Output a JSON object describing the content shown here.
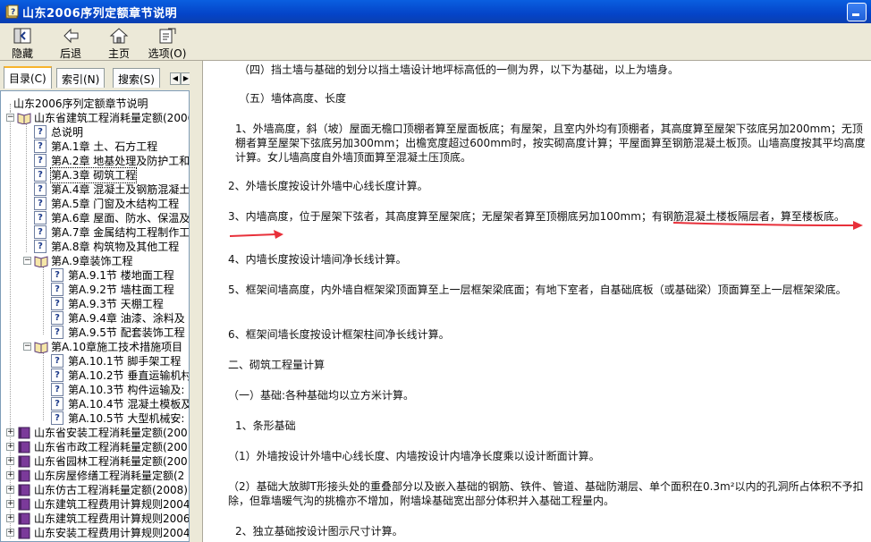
{
  "window": {
    "title": "山东2006序列定额章节说明"
  },
  "toolbar": {
    "buttons": [
      {
        "label": "隐藏",
        "icon": "hide-icon"
      },
      {
        "label": "后退",
        "icon": "back-arrow-icon"
      },
      {
        "label": "主页",
        "icon": "home-icon"
      },
      {
        "label": "选项(O)",
        "icon": "options-icon"
      }
    ]
  },
  "tabs": [
    {
      "label": "目录(C)",
      "active": true
    },
    {
      "label": "索引(N)",
      "active": false
    },
    {
      "label": "搜索(S)",
      "active": false
    }
  ],
  "tree": {
    "root": "山东2006序列定额章节说明",
    "items": [
      "山东省建筑工程消耗量定额(2006",
      "总说明",
      "第A.1章 土、石方工程",
      "第A.2章 地基处理及防护工和",
      "第A.3章 砌筑工程",
      "第A.4章 混凝土及钢筋混凝土",
      "第A.5章 门窗及木结构工程",
      "第A.6章 屋面、防水、保温及",
      "第A.7章 金属结构工程制作工和",
      "第A.8章 构筑物及其他工程",
      "第A.9章装饰工程",
      "第A.9.1节 楼地面工程",
      "第A.9.2节 墙柱面工程",
      "第A.9.3节 天棚工程",
      "第A.9.4章 油漆、涂料及",
      "第A.9.5节 配套装饰工程",
      "第A.10章施工技术措施项目",
      "第A.10.1节 脚手架工程",
      "第A.10.2节 垂直运输机村",
      "第A.10.3节 构件运输及:",
      "第A.10.4节 混凝土模板及",
      "第A.10.5节 大型机械安:",
      "山东省安装工程消耗量定额(200",
      "山东省市政工程消耗量定额(200",
      "山东省园林工程消耗量定额(200",
      "山东房屋修缮工程消耗量定额(2",
      "山东仿古工程消耗量定额(2008)",
      "山东建筑工程费用计算规则2004",
      "山东建筑工程费用计算规则2006",
      "山东安装工程费用计算规则2004"
    ]
  },
  "content": {
    "paragraphs": [
      "（四）挡土墙与基础的划分以挡土墙设计地坪标高低的一侧为界，以下为基础，以上为墙身。",
      "（五）墙体高度、长度",
      "1、外墙高度，斜（坡）屋面无檐口顶棚者算至屋面板底；有屋架，且室内外均有顶棚者，其高度算至屋架下弦底另加200mm；无顶棚者算至屋架下弦底另加300mm；出檐宽度超过600mm时，按实砌高度计算；平屋面算至钢筋混凝土板顶。山墙高度按其平均高度计算。女儿墙高度自外墙顶面算至混凝土压顶底。",
      "2、外墙长度按设计外墙中心线长度计算。",
      "3、内墙高度，位于屋架下弦者，其高度算至屋架底；无屋架者算至顶棚底另加100mm；有钢筋混凝土楼板隔层者，算至楼板底。",
      "4、内墙长度按设计墙间净长线计算。",
      "5、框架间墙高度，内外墙自框架梁顶面算至上一层框架梁底面；有地下室者，自基础底板（或基础梁）顶面算至上一层框架梁底。",
      "6、框架间墙长度按设计框架柱间净长线计算。",
      "二、砌筑工程量计算",
      "（一）基础:各种基础均以立方米计算。",
      "1、条形基础",
      "（1）外墙按设计外墙中心线长度、内墙按设计内墙净长度乘以设计断面计算。",
      "（2）基础大放脚T形接头处的重叠部分以及嵌入基础的钢筋、铁件、管道、基础防潮层、单个面积在0.3m²以内的孔洞所占体积不予扣除，但靠墙暖气沟的挑檐亦不增加，附墙垛基础宽出部分体积并入基础工程量内。",
      "2、独立基础按设计图示尺寸计算。"
    ]
  },
  "colors": {
    "titlebar": "#0A5FE0",
    "annotation_arrow": "#E8303A",
    "tab_highlight": "#F8B32B"
  }
}
